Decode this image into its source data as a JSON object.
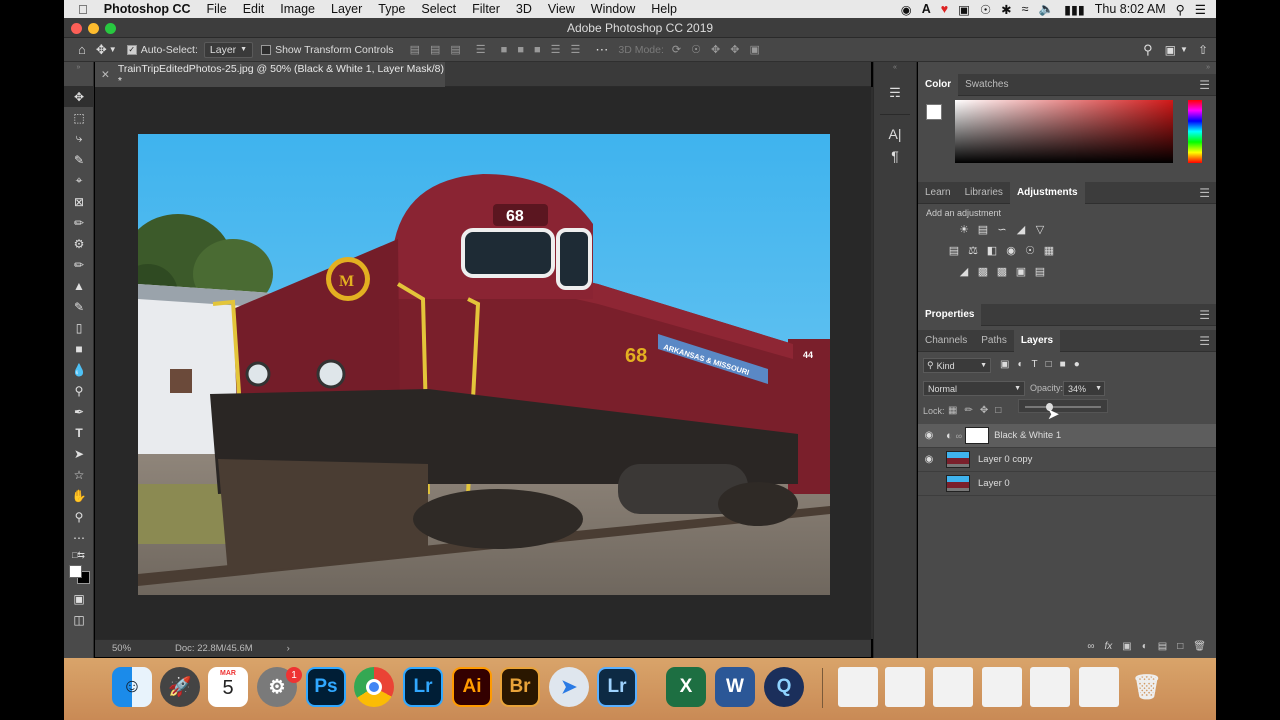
{
  "menubar": {
    "app_name": "Photoshop CC",
    "items": [
      "File",
      "Edit",
      "Image",
      "Layer",
      "Type",
      "Select",
      "Filter",
      "3D",
      "View",
      "Window",
      "Help"
    ],
    "clock": "Thu 8:02 AM"
  },
  "window": {
    "title": "Adobe Photoshop CC 2019"
  },
  "options_bar": {
    "auto_select_label": "Auto-Select:",
    "auto_select_target": "Layer",
    "show_transform_label": "Show Transform Controls",
    "mode_3d_label": "3D Mode:"
  },
  "document": {
    "tab_title": "TrainTripEditedPhotos-25.jpg @ 50% (Black & White 1, Layer Mask/8) *",
    "zoom": "50%",
    "doc_size": "Doc: 22.8M/45.6M",
    "train_number": "68",
    "trailing_car_number": "44",
    "railroad_name": "ARKANSAS & MISSOURI"
  },
  "color_panel": {
    "tabs": [
      "Color",
      "Swatches"
    ],
    "active": "Color"
  },
  "adjust_panel": {
    "tabs": [
      "Learn",
      "Libraries",
      "Adjustments"
    ],
    "active": "Adjustments",
    "hint": "Add an adjustment"
  },
  "properties_panel": {
    "title": "Properties"
  },
  "layers_panel": {
    "tabs": [
      "Channels",
      "Paths",
      "Layers"
    ],
    "active": "Layers",
    "filter_kind": "Kind",
    "blend_mode": "Normal",
    "opacity_label": "Opacity:",
    "opacity_value": "34%",
    "lock_label": "Lock:",
    "layers": [
      {
        "name": "Black & White 1",
        "visible": true,
        "selected": true
      },
      {
        "name": "Layer 0 copy",
        "visible": true,
        "selected": false
      },
      {
        "name": "Layer 0",
        "visible": false,
        "selected": false
      }
    ]
  },
  "dock": {
    "calendar_month": "MAR",
    "calendar_day": "5",
    "notification_badge": "1",
    "apps": [
      "Ps",
      "Lr",
      "Ai",
      "Br",
      "Lr"
    ]
  },
  "colors": {
    "accent_ps": "#31a8ff",
    "accent_ai": "#ff9a00",
    "accent_br": "#e8a33a",
    "train_maroon": "#7a1f2b",
    "sky": "#4fb8ec"
  }
}
